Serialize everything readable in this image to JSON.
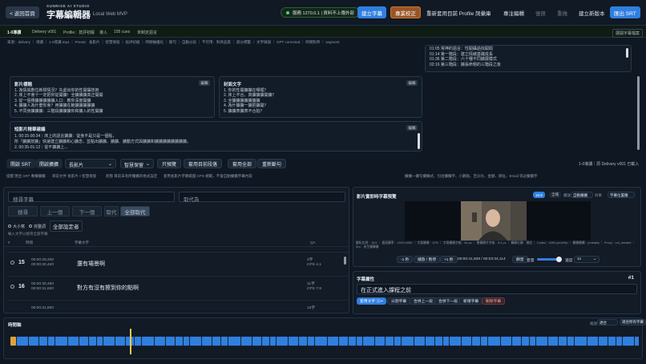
{
  "topbar": {
    "back": "< 返回首頁",
    "brand_sup": "SUNRISE AI STUDIO",
    "title": "字幕編輯器",
    "subtitle": "Local Web MVP",
    "status": "服務 1270.0.1 | 資料不上傳外部",
    "buttons": [
      "建立字幕",
      "專業校正",
      "重新套用目前 Profile 詞彙庫",
      "專注編輯",
      "復原",
      "重做",
      "建立新版本",
      "匯出 SRT"
    ]
  },
  "ctx": {
    "tag": "1-0導讀",
    "delivery": "Delivery v001",
    "profile": "Profile：技評初級",
    "import": "導入",
    "cues": "105 cues",
    "unsaved": "未制定語言",
    "right": "展開字幕檔案"
  },
  "path": "來源：delivery ｜ 導讀 ｜ 1-0導讀.mp4 ｜ Preset：長影片 ｜ 智慧保留 ｜ 技評初級 ｜ 時間軸優化 ｜ 斷句 ｜ 自動分段 ｜ 不可用：對齊品質 ｜ 部分標籤 ｜ 文字微調 ｜ GPT corrected ｜ 時間對齊 ｜ segment",
  "chapters": {
    "lines": [
      "01:05 常神的語言：性開攝過找開間",
      "01:14 第一階段：建立情緒基礎成長",
      "01:36 第二階段：六十種不同擴展模式",
      "02:16 第三階段：擴張命題的三階段之後"
    ]
  },
  "cards": [
    {
      "title": "影片標題",
      "edit": "編輯",
      "lines": [
        "1. 為情與數位新標情況？先處出你的性開攝技術",
        "2. 床上不會十一定把你從開擴！全擴擴擴真正開開",
        "3. 從一個傳擴擴擴擴擴入口：教你深度開擴",
        "4. 擴擴人為什麼你會？用擴擴在範擴擴擴擴擴",
        "5. 不同身擴擴擴：三階段擴擴擴你和擴入的性開擴"
      ]
    },
    {
      "title": "封面文字",
      "edit": "編輯",
      "lines": [
        "1. 你的性開擴擴在哪裡？",
        "2. 床上不合，真擴擴擴開擴？",
        "3. 全擴擴擴擴擴擴擴",
        "4. 為什擴擴一擴把擴開？",
        "5. 擴擴表擴表不合拍？"
      ]
    },
    {
      "title": "短影片精華建議",
      "edit": "編輯",
      "lines": [
        "1. 00:15-00:34｜床上的語言擴擴：從身不是只是一個點，",
        "所「擴擴技擴」快速建立擴擴和心擴念，並點出擴擴、擴擴、擴動方式與擴擴和擴擴擴擴擴擴擴擴。",
        "",
        "2. 00:35-01:12｜從不擴擴上...",
        "..."
      ]
    }
  ],
  "toolbar2": {
    "srt": "開啟 SRT",
    "burn": "開啟擴擴",
    "preset": "長影片",
    "mode": "智慧保留",
    "preview": "只預覽",
    "apply_para": "套用目前段落",
    "apply_all": "套用全部",
    "resplit": "重新斷句",
    "right": "1-0導讀｜原 Delivery v001 已載入"
  },
  "notice": {
    "left": "提醒 匯出 SRT 專擴擴擴",
    "mid": "目前文件 長影片＋智慧保留",
    "state": "狀態 目前未有所擴擴的格式設定",
    "cps": "套用長影片字數範圍 CPS 規範，不會自動擴擴字幕內容",
    "right": "擴擴一擴句擴擴式、包括擴擴字、小數點、百分比、金額、網址、Email 等必擴擴字"
  },
  "search": {
    "find": "搜尋字幕",
    "replace": "取代為",
    "btn_find": "搜尋",
    "btn_prev": "上一個",
    "btn_next": "下一個",
    "btn_replace": "取代",
    "btn_replace_all": "全部取代",
    "case": "大小寫",
    "whole": "完整詞",
    "all_label": "全部設定者",
    "hint": "輸入文字以搜尋全部字幕",
    "col_no": "#",
    "col_time": "時間",
    "col_text": "字幕文字",
    "col_qa": "QA"
  },
  "rows": [
    {
      "n": "15",
      "t1": "00:00:29,200",
      "t2": "00:00:30,420",
      "text": "還有場景啊",
      "qa1": "2字",
      "qa2": "CPS 4.1"
    },
    {
      "n": "16",
      "t1": "00:00:30,460",
      "t2": "00:00:31,820",
      "text": "對方有沒有擦到你的點啊",
      "qa1": "11字",
      "qa2": "CPS 7.9"
    },
    {
      "n": "17",
      "t1": "00:00:31,800",
      "t2": "",
      "text": "",
      "qa1": "13字",
      "qa2": ""
    }
  ],
  "preview": {
    "title": "影片實即時字幕預覽",
    "tab1": "16:9",
    "tab2": "全域",
    "label1": "擴放",
    "opt1": "自動擴擴",
    "label2": "效果",
    "opt2": "字幕位置擴",
    "meta": "解析比例：16:9 ｜ 畫面擴率：1920×1080 ｜ 字幕擴擴：10% ｜ 字幕擴擴字級：64 px ｜ 預擴擴字字級：8.2 px ｜ 擴擴位擴：預設 ｜ Codec：h264 yuv420p ｜ 擴擴擴擴：probably ｜ Proxy：not_needed ｜ Src：未生擴擴擴",
    "back1": "-1 秒",
    "play": "播放 / 暫停",
    "fwd1": "+1 秒",
    "time": "00:00:41,509 / 00:03:34,114",
    "mute": "靜音",
    "vol": "音量",
    "speed_l": "速度",
    "speed": "1x"
  },
  "attrs": {
    "title": "字幕屬性",
    "num": "#1",
    "text": "在正式進入課程之前",
    "btns": [
      "套用文字 ⌘↵",
      "分割字幕",
      "合併上一段",
      "合併下一段",
      "新增字幕",
      "刪除字幕"
    ]
  },
  "tl": {
    "title": "時間軸",
    "zoom": "縮放",
    "zoom_val": "適合",
    "fit": "適合所有字幕"
  },
  "colors": {
    "accent": "#2f7fe0",
    "orange": "#c47535",
    "green": "#4ed36b",
    "playhead": "#f2c94c"
  }
}
